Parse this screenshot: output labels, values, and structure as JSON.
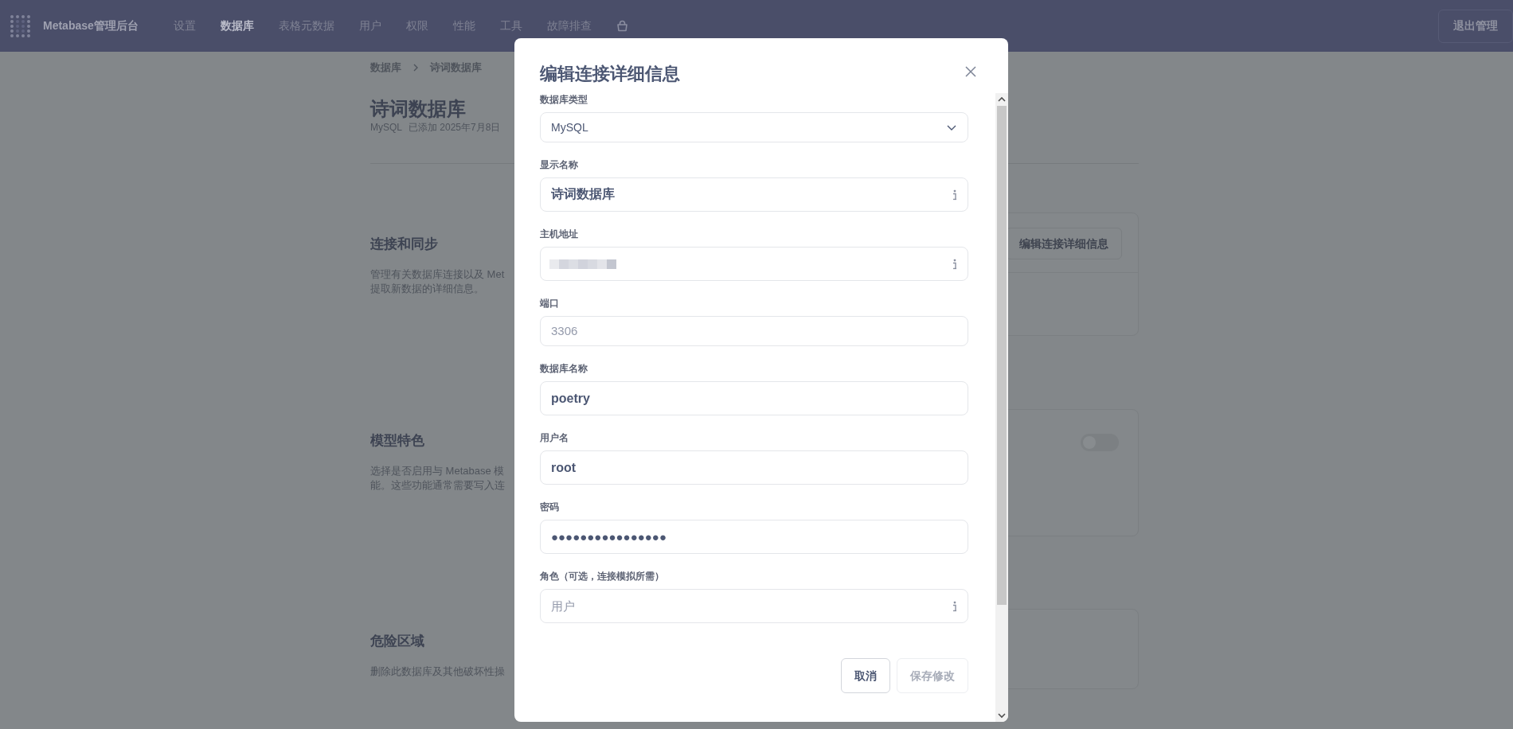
{
  "navbar": {
    "brand": "Metabase管理后台",
    "items": [
      {
        "label": "设置",
        "selected": false
      },
      {
        "label": "数据库",
        "selected": true
      },
      {
        "label": "表格元数据",
        "selected": false
      },
      {
        "label": "用户",
        "selected": false
      },
      {
        "label": "权限",
        "selected": false
      },
      {
        "label": "性能",
        "selected": false
      },
      {
        "label": "工具",
        "selected": false
      },
      {
        "label": "故障排查",
        "selected": false
      }
    ],
    "exit_button": "退出管理"
  },
  "breadcrumb": [
    "数据库",
    "诗词数据库"
  ],
  "page": {
    "title": "诗词数据库",
    "engine": "MySQL",
    "added": "已添加 2025年7月8日"
  },
  "sections": [
    {
      "title": "连接和同步",
      "description": [
        "管理有关数据库连接以及 Met",
        "提取新数据的详细信息。"
      ],
      "kind": "button",
      "button": "编辑连接详细信息"
    },
    {
      "title": "模型特色",
      "description": [
        "选择是否启用与 Metabase 模",
        "能。这些功能通常需要写入连"
      ],
      "kind": "toggle",
      "on": false
    },
    {
      "title": "危险区域",
      "description": [
        "删除此数据库及其他破坏性操"
      ],
      "kind": "empty"
    }
  ],
  "modal": {
    "title": "编辑连接详细信息",
    "fields": [
      {
        "label": "数据库类型",
        "kind": "select",
        "value": "MySQL"
      },
      {
        "label": "显示名称",
        "kind": "text",
        "value": "诗词数据库",
        "info": true
      },
      {
        "label": "主机地址",
        "kind": "text",
        "redacted": true,
        "info": true
      },
      {
        "label": "端口",
        "kind": "text",
        "placeholder": "3306"
      },
      {
        "label": "数据库名称",
        "kind": "text",
        "value": "poetry"
      },
      {
        "label": "用户名",
        "kind": "text",
        "value": "root"
      },
      {
        "label": "密码",
        "kind": "password",
        "value": "●●●●●●●●●●●●●●●●"
      },
      {
        "label": "角色（可选，连接模拟所需）",
        "kind": "text",
        "placeholder": "用户",
        "info": true
      }
    ],
    "buttons": [
      {
        "label": "取消",
        "disabled": false
      },
      {
        "label": "保存修改",
        "disabled": true
      }
    ]
  }
}
